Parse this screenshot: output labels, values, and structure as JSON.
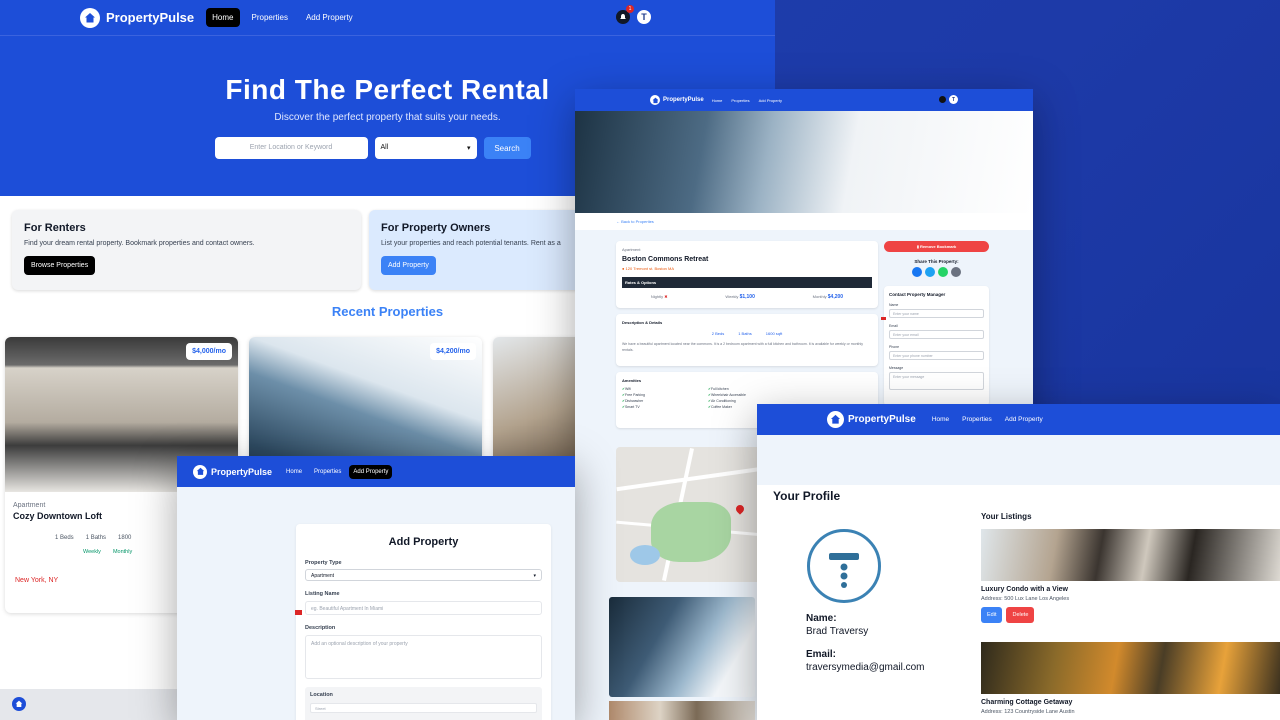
{
  "brand": {
    "name": "PropertyPulse"
  },
  "nav": {
    "home": "Home",
    "properties": "Properties",
    "add_property": "Add Property"
  },
  "notifications": {
    "count": "1"
  },
  "user": {
    "initial": "T"
  },
  "hero": {
    "title": "Find The Perfect Rental",
    "subtitle": "Discover the perfect property that suits your needs.",
    "search_placeholder": "Enter Location or Keyword",
    "type_selected": "All",
    "search_button": "Search"
  },
  "info_cards": [
    {
      "title": "For Renters",
      "text": "Find your dream rental property. Bookmark properties and contact owners.",
      "button": "Browse Properties"
    },
    {
      "title": "For Property Owners",
      "text": "List your properties and reach potential tenants. Rent as a",
      "button": "Add Property"
    }
  ],
  "recent": {
    "heading": "Recent Properties",
    "cards": [
      {
        "price": "$4,000/mo",
        "type": "Apartment",
        "title": "Cozy Downtown Loft",
        "beds": "1 Beds",
        "baths": "1 Baths",
        "sqft": "1800",
        "rate1": "Weekly",
        "rate2": "Monthly",
        "location": "New York, NY"
      },
      {
        "price": "$4,200/mo"
      },
      {}
    ]
  },
  "detail": {
    "back_link": "Back to Properties",
    "type": "Apartment",
    "title": "Boston Commons Retreat",
    "address": "120 Tremont st. Boston MA",
    "rates_heading": "Rates & Options",
    "nightly_label": "Nightly",
    "weekly_label": "Weekly",
    "weekly_value": "$1,100",
    "monthly_label": "Monthly",
    "monthly_value": "$4,200",
    "description_heading": "Description & Details",
    "beds": "2 Beds",
    "baths": "1 Baths",
    "sqft": "1600 sqft",
    "description": "We have a beautiful apartment located near the commons. It is a 2 bedroom apartment with a full kitchen and bathroom. It is available for weekly or monthly rentals.",
    "amenities_heading": "Amenities",
    "amenities": [
      "Wifi",
      "Full kitchen",
      "Free Parking",
      "Wheelchair Accessible",
      "Dishwasher",
      "Air Conditioning",
      "Smart TV",
      "Coffee Maker"
    ],
    "remove_bookmark": "Remove Bookmark",
    "share_heading": "Share This Property:",
    "contact_heading": "Contact Property Manager",
    "contact_fields": [
      {
        "label": "Name",
        "placeholder": "Enter your name"
      },
      {
        "label": "Email",
        "placeholder": "Enter your email"
      },
      {
        "label": "Phone",
        "placeholder": "Enter your phone number"
      },
      {
        "label": "Message",
        "placeholder": "Enter your message"
      }
    ]
  },
  "add_form": {
    "title": "Add Property",
    "type_label": "Property Type",
    "type_value": "Apartment",
    "name_label": "Listing Name",
    "name_placeholder": "eg. Beautiful Apartment In Miami",
    "description_label": "Description",
    "description_placeholder": "Add an optional description of your property",
    "location_label": "Location",
    "street_placeholder": "Street"
  },
  "profile": {
    "title": "Your Profile",
    "name_label": "Name:",
    "name": "Brad Traversy",
    "email_label": "Email:",
    "email": "traversymedia@gmail.com",
    "listings_heading": "Your Listings",
    "listings": [
      {
        "title": "Luxury Condo with a View",
        "address": "Address: 500 Lux Lane Los Angeles",
        "edit": "Edit",
        "delete": "Delete"
      },
      {
        "title": "Charming Cottage Getaway",
        "address": "Address: 123 Countryside Lane Austin"
      }
    ]
  },
  "colors": {
    "primary": "#1d4ed8",
    "accent": "#3b82f6",
    "danger": "#ef4444",
    "success": "#16a34a"
  }
}
